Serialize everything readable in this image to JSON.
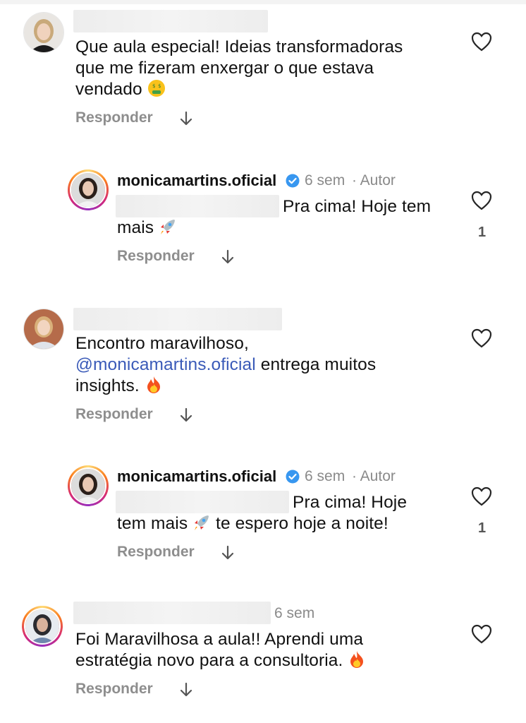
{
  "comments": [
    {
      "text": "Que aula especial! Ideias transformadoras que me fizeram enxergar o que estava vendado",
      "line1": "Que aula especial! Ideias transformadoras",
      "line2": "que me fizeram enxergar o que estava",
      "line3": "vendado",
      "emoji": "money-mouth-face",
      "reply_label": "Responder"
    },
    {
      "username": "monicamartins.oficial",
      "time": "6 sem",
      "author_tag": "· Autor",
      "line1": "Pra cima! Hoje tem",
      "line2": "mais",
      "emoji": "rocket",
      "likes": "1",
      "reply_label": "Responder"
    },
    {
      "line1": "Encontro maravilhoso,",
      "mention": "@monicamartins.oficial",
      "line2_rest": " entrega muitos",
      "line3": "insights.",
      "emoji": "fire",
      "reply_label": "Responder"
    },
    {
      "username": "monicamartins.oficial",
      "time": "6 sem",
      "author_tag": "· Autor",
      "line1": "Pra cima! Hoje",
      "line2a": "tem mais",
      "line2b": "te espero hoje a noite!",
      "emoji": "rocket",
      "likes": "1",
      "reply_label": "Responder"
    },
    {
      "time": "6 sem",
      "line1": "Foi Maravilhosa a aula!! Aprendi uma",
      "line2": "estratégia novo para a consultoria.",
      "emoji": "fire",
      "reply_label": "Responder"
    }
  ],
  "icons": {
    "like": "heart-outline-icon",
    "arrow": "arrow-down-icon",
    "verified": "verified-badge-icon"
  },
  "colors": {
    "mention": "#3a5ab8",
    "verified": "#3897f0",
    "muted": "#8e8e8e"
  }
}
